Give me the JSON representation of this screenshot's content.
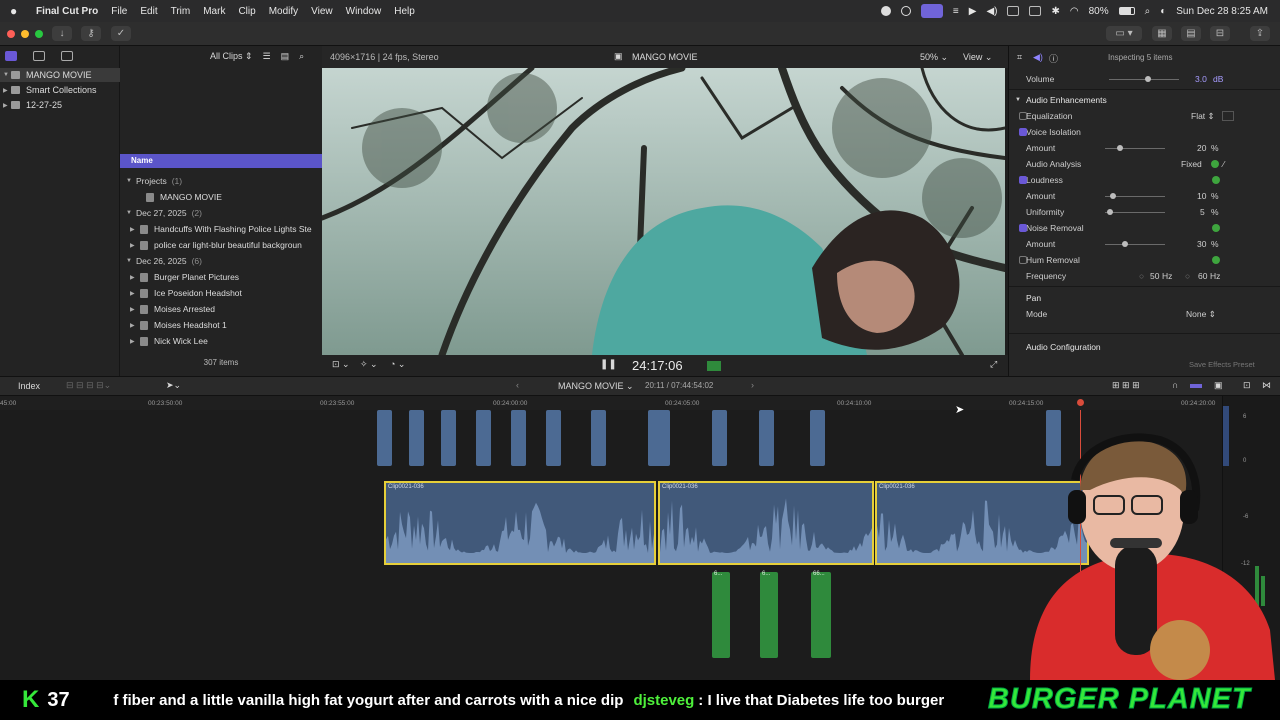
{
  "menubar": {
    "app_name": "Final Cut Pro",
    "items": [
      "File",
      "Edit",
      "Trim",
      "Mark",
      "Clip",
      "Modify",
      "View",
      "Window",
      "Help"
    ],
    "battery": "80%",
    "datetime": "Sun Dec 28  8:25 AM"
  },
  "sidebar": {
    "items": [
      {
        "label": "MANGO MOVIE",
        "icon": "library-icon"
      },
      {
        "label": "Smart Collections",
        "icon": "folder-icon"
      },
      {
        "label": "12-27-25",
        "icon": "event-icon"
      }
    ]
  },
  "browser": {
    "filter": "All Clips",
    "column_name": "Name",
    "groups": [
      {
        "label": "Projects",
        "count": "(1)",
        "items": [
          "MANGO MOVIE"
        ]
      },
      {
        "label": "Dec 27, 2025",
        "count": "(2)",
        "items": [
          "Handcuffs With Flashing Police Lights Ste",
          "police car light-blur beautiful backgroun"
        ]
      },
      {
        "label": "Dec 26, 2025",
        "count": "(6)",
        "items": [
          "Burger Planet Pictures",
          "Ice Poseidon Headshot",
          "Moises Arrested",
          "Moises Headshot 1",
          "Nick Wick Lee"
        ]
      }
    ],
    "item_count": "307 items"
  },
  "viewer": {
    "format": "4096×1716 | 24 fps, Stereo",
    "title": "MANGO MOVIE",
    "zoom": "50%",
    "view_label": "View",
    "timecode": "24:17:06"
  },
  "inspector": {
    "title": "Inspecting 5 items",
    "volume_label": "Volume",
    "volume_value": "3.0",
    "volume_unit": "dB",
    "section_enhancements": "Audio Enhancements",
    "equalization_label": "Equalization",
    "equalization_value": "Flat",
    "voice_isolation": "Voice Isolation",
    "vi_amount_label": "Amount",
    "vi_amount": "20",
    "audio_analysis": "Audio Analysis",
    "audio_analysis_value": "Fixed",
    "loudness": "Loudness",
    "loud_amount_label": "Amount",
    "loud_amount": "10",
    "uniformity_label": "Uniformity",
    "uniformity": "5",
    "noise_removal": "Noise Removal",
    "nr_amount_label": "Amount",
    "nr_amount": "30",
    "hum_removal": "Hum Removal",
    "frequency_label": "Frequency",
    "freq_50": "50",
    "freq_60": "60",
    "pct": "%",
    "hz": "Hz",
    "pan": "Pan",
    "mode_label": "Mode",
    "mode_value": "None",
    "audio_config": "Audio Configuration",
    "save_preset": "Save Effects Preset"
  },
  "timeline": {
    "index_label": "Index",
    "project": "MANGO MOVIE",
    "duration": "20:11 / 07:44:54:02",
    "ruler": [
      "00:23:50:00",
      "00:23:55:00",
      "00:24:00:00",
      "00:24:05:00",
      "00:24:10:00",
      "00:24:15:00",
      "00:24:20:00"
    ],
    "clip_names": [
      "Clip0021-036",
      "Clip0021-036",
      "Clip0021-036"
    ],
    "green_labels": [
      "6...",
      "6...",
      "66..."
    ]
  },
  "ticker": {
    "count": "37",
    "message": "f fiber and a little vanilla high fat yogurt after and carrots with a nice dip",
    "user": "djsteveg",
    "chat": ": I live that Diabetes life too burger",
    "brand": "BURGER PLANET"
  },
  "colors": {
    "accent": "#6a58d6",
    "selection": "#5b55c9",
    "clip_border": "#e6cf39",
    "brand_green": "#35e83a"
  }
}
